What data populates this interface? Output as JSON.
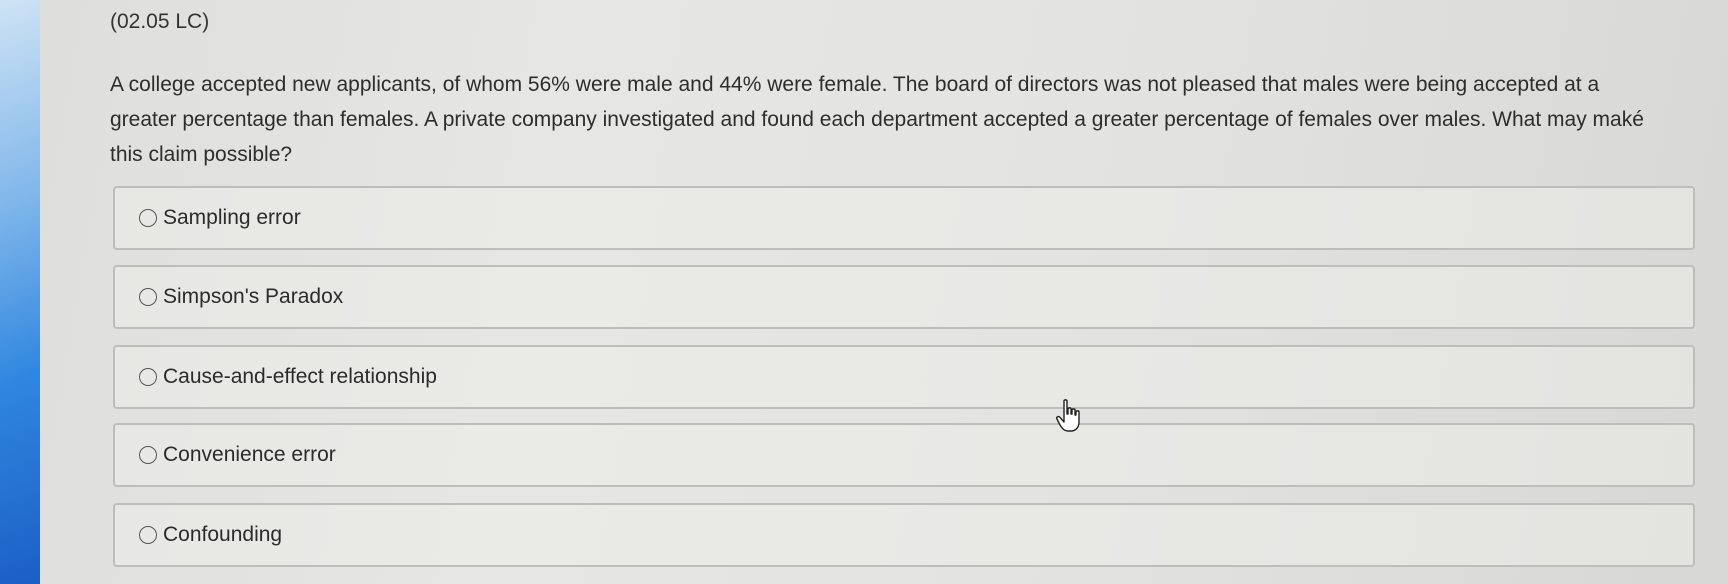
{
  "question": {
    "code": "(02.05 LC)",
    "text": "A college accepted new applicants, of whom 56% were male and 44% were female. The board of directors was not pleased that males were being accepted at a greater percentage than females. A private company investigated and found each department accepted a greater percentage of females over males. What may maké this claim possible?"
  },
  "options": [
    {
      "label": "Sampling error"
    },
    {
      "label": "Simpson's Paradox"
    },
    {
      "label": "Cause-and-effect relationship"
    },
    {
      "label": "Convenience error"
    },
    {
      "label": "Confounding"
    }
  ],
  "icons": {
    "radio": "radio-empty-icon",
    "cursor": "hand-pointer-icon"
  }
}
